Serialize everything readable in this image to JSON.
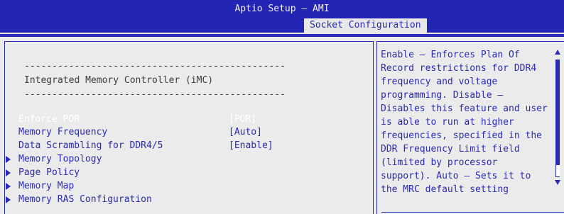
{
  "app": {
    "title": "Aptio Setup – AMI"
  },
  "tab": {
    "label": "Socket Configuration"
  },
  "menu": {
    "separator": "-----------------------------------------------",
    "section_title": "Integrated Memory Controller (iMC)",
    "settings": [
      {
        "label": "Enforce POR",
        "value": "[POR]"
      },
      {
        "label": "Memory Frequency",
        "value": "[Auto]"
      },
      {
        "label": "Data Scrambling for DDR4/5",
        "value": "[Enable]"
      }
    ],
    "submenus": [
      {
        "label": "Memory Topology"
      },
      {
        "label": "Page Policy"
      },
      {
        "label": "Memory Map"
      },
      {
        "label": "Memory RAS Configuration"
      }
    ]
  },
  "help": {
    "lines": [
      "Enable – Enforces Plan Of",
      "Record restrictions for DDR4",
      "frequency and voltage",
      "programming. Disable –",
      "Disables this feature and user",
      "is able to run at higher",
      "frequencies, specified in the",
      "DDR Frequency Limit field",
      "(limited by processor",
      "support). Auto – Sets it to",
      "the MRC default setting"
    ]
  },
  "colors": {
    "accent": "#2a2ab6",
    "panel_background": "#ebebeb",
    "header_background": "#2424b4",
    "selected_text": "#ffffff"
  }
}
